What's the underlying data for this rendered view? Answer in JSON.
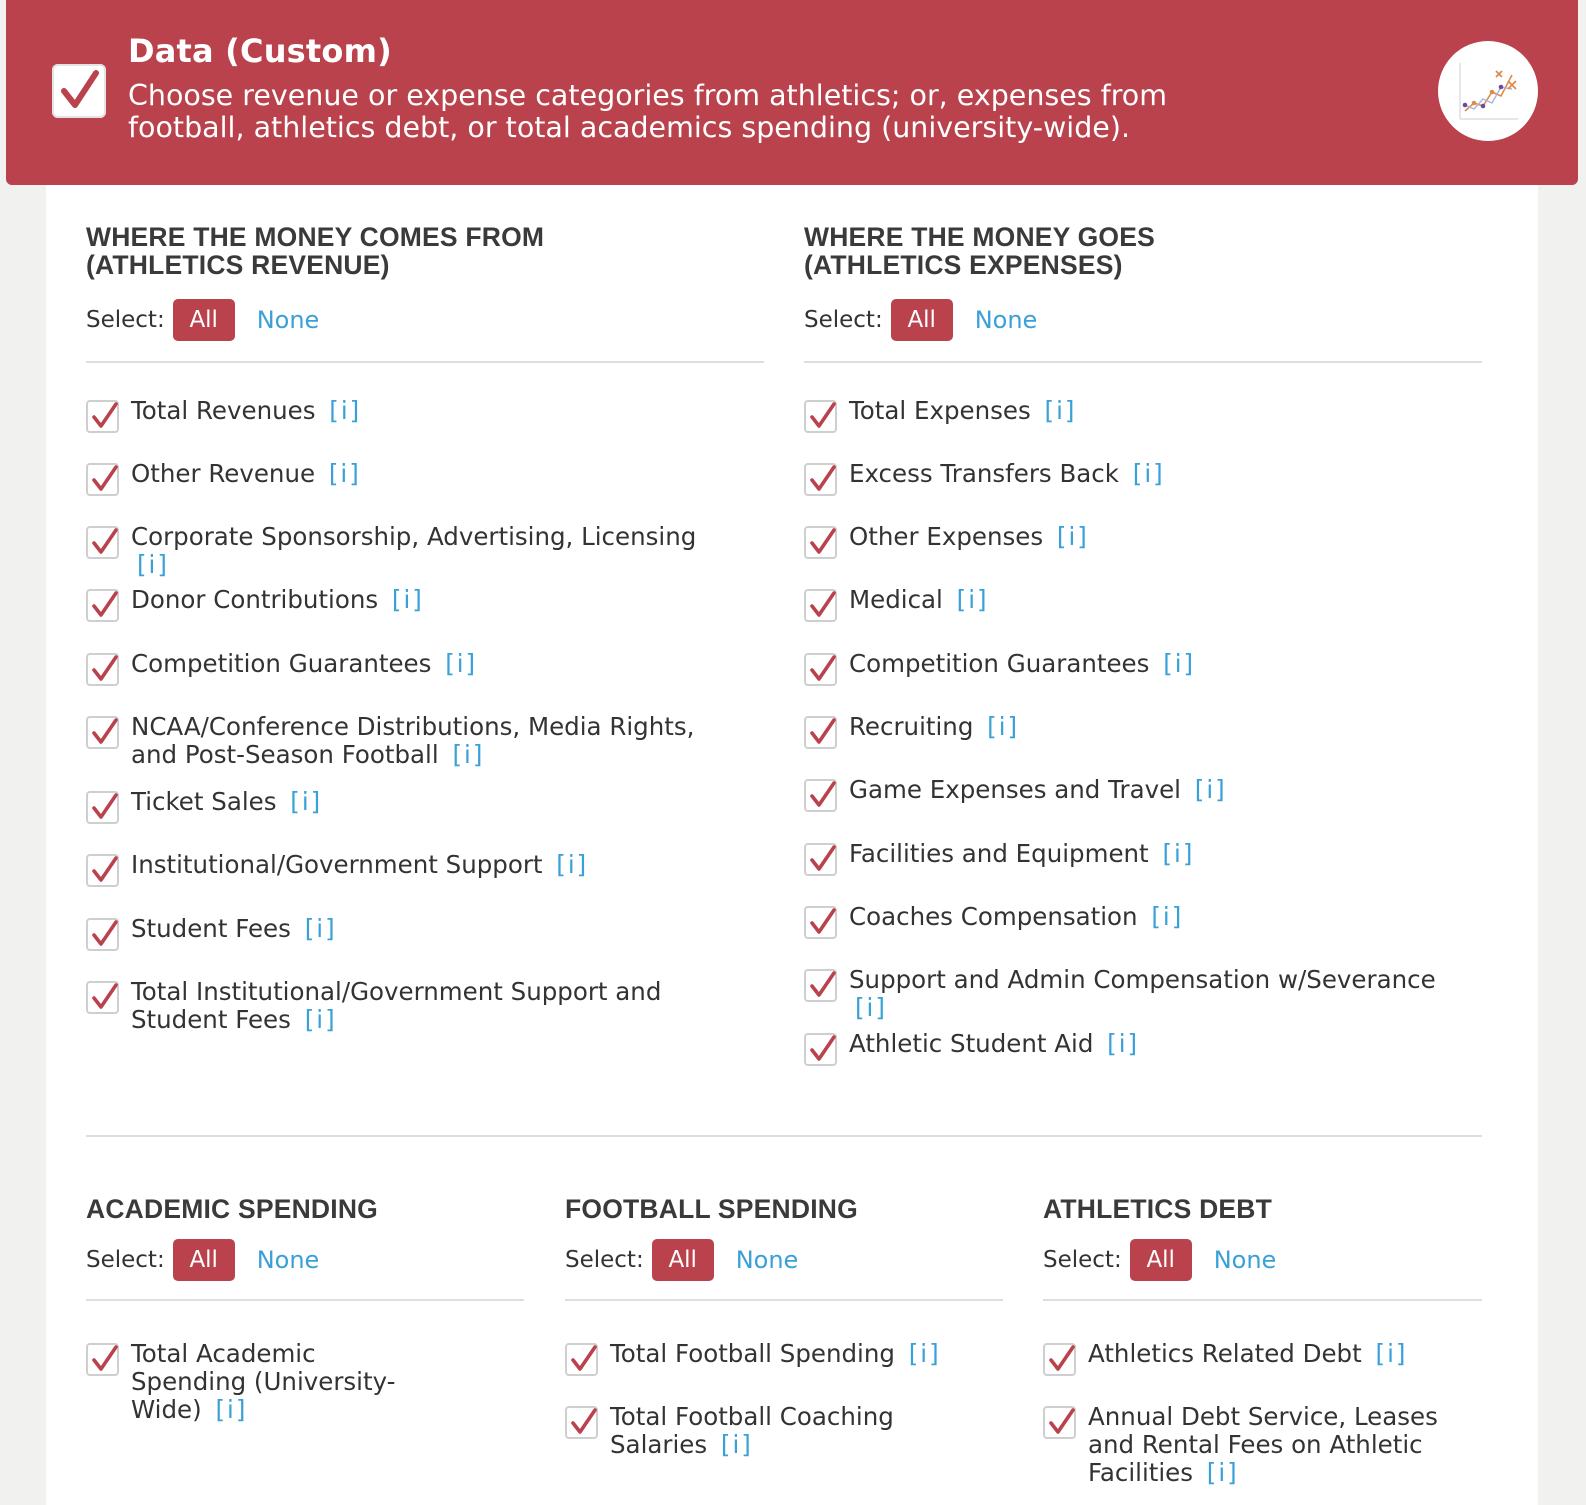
{
  "header": {
    "title": "Data (Custom)",
    "description": "Choose revenue or expense categories from athletics; or, expenses from football, athletics debt, or total academics spending (university-wide).",
    "chart_icon": "scatter-chart-icon"
  },
  "colors": {
    "accent": "#b9424d",
    "link": "#3aa0d8",
    "divider": "#dedede"
  },
  "common": {
    "select_label": "Select:",
    "all_label": "All",
    "none_label": "None",
    "info_label": "[i]"
  },
  "revenue": {
    "title": "WHERE THE MONEY COMES FROM\n(ATHLETICS REVENUE)",
    "items": [
      {
        "label": "Total Revenues",
        "checked": true
      },
      {
        "label": "Other Revenue",
        "checked": true
      },
      {
        "label": "Corporate Sponsorship, Advertising, Licensing",
        "checked": true
      },
      {
        "label": "Donor Contributions",
        "checked": true
      },
      {
        "label": "Competition Guarantees",
        "checked": true
      },
      {
        "label": "NCAA/Conference Distributions, Media Rights, and Post-Season Football",
        "checked": true
      },
      {
        "label": "Ticket Sales",
        "checked": true
      },
      {
        "label": "Institutional/Government Support",
        "checked": true
      },
      {
        "label": "Student Fees",
        "checked": true
      },
      {
        "label": "Total Institutional/Government Support and Student Fees",
        "checked": true
      }
    ]
  },
  "expenses": {
    "title": "WHERE THE MONEY GOES\n(ATHLETICS EXPENSES)",
    "items": [
      {
        "label": "Total Expenses",
        "checked": true
      },
      {
        "label": "Excess Transfers Back",
        "checked": true
      },
      {
        "label": "Other Expenses",
        "checked": true
      },
      {
        "label": "Medical",
        "checked": true
      },
      {
        "label": "Competition Guarantees",
        "checked": true
      },
      {
        "label": "Recruiting",
        "checked": true
      },
      {
        "label": "Game Expenses and Travel",
        "checked": true
      },
      {
        "label": "Facilities and Equipment",
        "checked": true
      },
      {
        "label": "Coaches Compensation",
        "checked": true
      },
      {
        "label": "Support and Admin Compensation w/Severance",
        "checked": true
      },
      {
        "label": "Athletic Student Aid",
        "checked": true
      }
    ]
  },
  "academic": {
    "title": "ACADEMIC SPENDING",
    "items": [
      {
        "label": "Total Academic Spending (University-Wide)",
        "checked": true
      }
    ]
  },
  "football": {
    "title": "FOOTBALL SPENDING",
    "items": [
      {
        "label": "Total Football Spending",
        "checked": true
      },
      {
        "label": "Total Football Coaching Salaries",
        "checked": true
      }
    ]
  },
  "debt": {
    "title": "ATHLETICS DEBT",
    "items": [
      {
        "label": "Athletics Related Debt",
        "checked": true
      },
      {
        "label": "Annual Debt Service, Leases and Rental Fees on Athletic Facilities",
        "checked": true
      }
    ]
  }
}
